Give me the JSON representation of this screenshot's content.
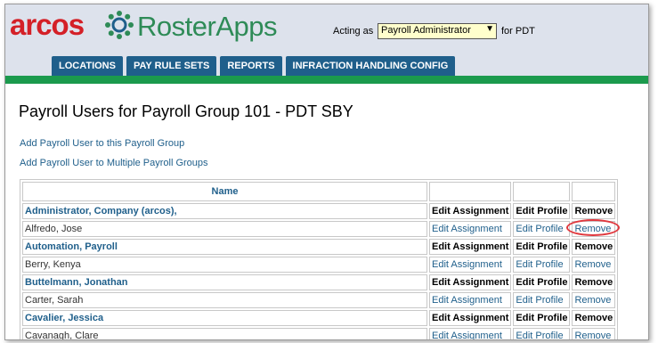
{
  "brand": {
    "arcos": "arcos",
    "product": "RosterApps"
  },
  "acting": {
    "label": "Acting as",
    "selected": "Payroll Administrator",
    "suffix": "for PDT"
  },
  "tabs": [
    "LOCATIONS",
    "PAY RULE SETS",
    "REPORTS",
    "INFRACTION HANDLING CONFIG"
  ],
  "page": {
    "title": "Payroll Users for Payroll Group 101 - PDT SBY",
    "links": [
      "Add Payroll User to this Payroll Group",
      "Add Payroll User to Multiple Payroll Groups"
    ]
  },
  "table": {
    "headers": {
      "name": "Name"
    },
    "rows": [
      {
        "name": "Administrator, Company (arcos),",
        "assign": "Edit Assignment",
        "profile": "Edit Profile",
        "remove": "Remove"
      },
      {
        "name": "Alfredo, Jose",
        "assign": "Edit Assignment",
        "profile": "Edit Profile",
        "remove": "Remove"
      },
      {
        "name": "Automation, Payroll",
        "assign": "Edit Assignment",
        "profile": "Edit Profile",
        "remove": "Remove"
      },
      {
        "name": "Berry, Kenya",
        "assign": "Edit Assignment",
        "profile": "Edit Profile",
        "remove": "Remove"
      },
      {
        "name": "Buttelmann, Jonathan",
        "assign": "Edit Assignment",
        "profile": "Edit Profile",
        "remove": "Remove"
      },
      {
        "name": "Carter, Sarah",
        "assign": "Edit Assignment",
        "profile": "Edit Profile",
        "remove": "Remove"
      },
      {
        "name": "Cavalier, Jessica",
        "assign": "Edit Assignment",
        "profile": "Edit Profile",
        "remove": "Remove"
      },
      {
        "name": "Cavanagh, Clare",
        "assign": "Edit Assignment",
        "profile": "Edit Profile",
        "remove": "Remove"
      }
    ]
  },
  "colors": {
    "brand_red": "#d42027",
    "brand_green": "#2e8b57",
    "tab_blue": "#1f5f8b",
    "link_blue": "#1f5f8b",
    "highlight": "#e0383e"
  }
}
